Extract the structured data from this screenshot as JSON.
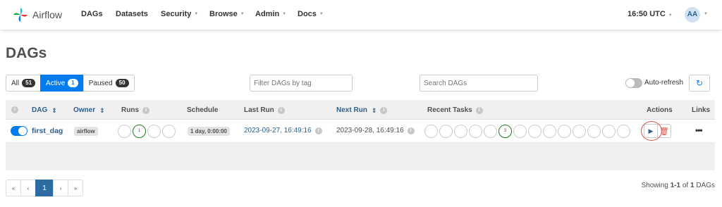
{
  "navbar": {
    "brand": "Airflow",
    "items": [
      "DAGs",
      "Datasets",
      "Security",
      "Browse",
      "Admin",
      "Docs"
    ],
    "clock": "16:50 UTC",
    "avatar_initials": "AA"
  },
  "page": {
    "title": "DAGs"
  },
  "filters": {
    "all_label": "All",
    "all_count": "51",
    "active_label": "Active",
    "active_count": "1",
    "paused_label": "Paused",
    "paused_count": "50",
    "tag_placeholder": "Filter DAGs by tag",
    "search_placeholder": "Search DAGs",
    "autorefresh_label": "Auto-refresh",
    "autorefresh_enabled": false
  },
  "table": {
    "headers": {
      "dag": "DAG",
      "owner": "Owner",
      "runs": "Runs",
      "schedule": "Schedule",
      "last_run": "Last Run",
      "next_run": "Next Run",
      "recent_tasks": "Recent Tasks",
      "actions": "Actions",
      "links": "Links"
    },
    "rows": [
      {
        "active": true,
        "dag_id": "first_dag",
        "owner": "airflow",
        "runs": [
          "",
          "1",
          "",
          ""
        ],
        "runs_success_index": 1,
        "schedule": "1 day, 0:00:00",
        "last_run": "2023-09-27, 16:49:16",
        "next_run": "2023-09-28, 16:49:16",
        "recent_tasks": [
          "",
          "",
          "",
          "",
          "",
          "3",
          "",
          "",
          "",
          "",
          "",
          "",
          "",
          ""
        ],
        "recent_tasks_success_index": 5
      }
    ]
  },
  "pagination": {
    "first": "«",
    "prev": "‹",
    "current": "1",
    "next": "›",
    "last": "»",
    "showing_prefix": "Showing ",
    "showing_range": "1-1",
    "showing_of": " of ",
    "showing_total": "1",
    "showing_suffix": " DAGs"
  },
  "colors": {
    "accent": "#017cee",
    "link": "#2d5f8b",
    "success": "#1e7b1e",
    "danger": "#d9534f"
  }
}
